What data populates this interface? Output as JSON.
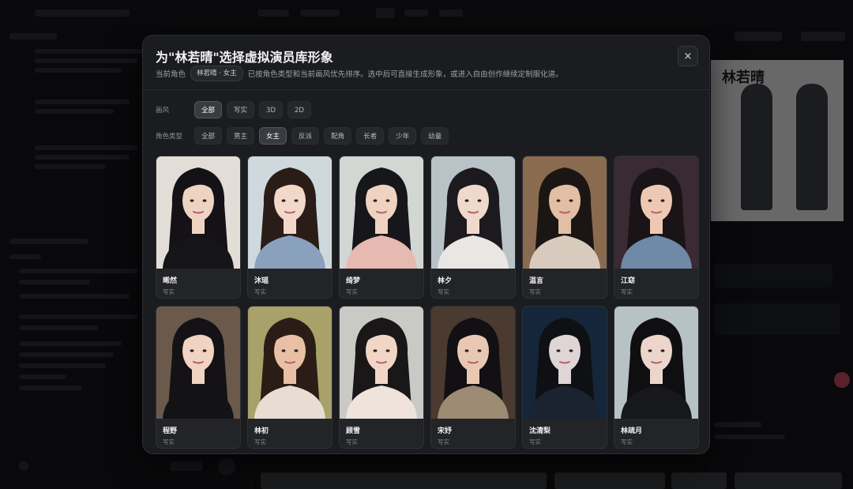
{
  "modal": {
    "title": "为\"林若晴\"选择虚拟演员库形象",
    "subtitle_prefix": "当前角色",
    "current_role_chip": "林若晴 · 女主",
    "subtitle_desc": "已按角色类型和当前画风优先排序。选中后可直接生成形象，或进入自由创作继续定制服化道。",
    "close_label": "×"
  },
  "filters": {
    "style": {
      "label": "画风",
      "options": [
        "全部",
        "写实",
        "3D",
        "2D"
      ],
      "selected": "全部"
    },
    "role_type": {
      "label": "角色类型",
      "options": [
        "全部",
        "男主",
        "女主",
        "反派",
        "配角",
        "长者",
        "少年",
        "幼童"
      ],
      "selected": "女主"
    }
  },
  "actors": [
    {
      "name": "晞然",
      "style": "写实",
      "bg": "#e3ddd8",
      "hair": "#141216",
      "skin": "#efd3c2",
      "cloth": "#151518"
    },
    {
      "name": "沐瑶",
      "style": "写实",
      "bg": "#cfd9dd",
      "hair": "#2a1d18",
      "skin": "#f1d8c9",
      "cloth": "#8aa1bd"
    },
    {
      "name": "绮梦",
      "style": "写实",
      "bg": "#d3d7d4",
      "hair": "#17161a",
      "skin": "#efd2c0",
      "cloth": "#e6b9b1"
    },
    {
      "name": "林夕",
      "style": "写实",
      "bg": "#b9c2c6",
      "hair": "#1c1a1e",
      "skin": "#efd8cc",
      "cloth": "#e9e6e4"
    },
    {
      "name": "温言",
      "style": "写实",
      "bg": "#8a6b50",
      "hair": "#1b1614",
      "skin": "#e2bea4",
      "cloth": "#d8cbbd"
    },
    {
      "name": "江窈",
      "style": "写实",
      "bg": "#3a2a34",
      "hair": "#1a1416",
      "skin": "#edc9b3",
      "cloth": "#6f8aa6"
    },
    {
      "name": "程野",
      "style": "写实",
      "bg": "#6b5a4c",
      "hair": "#141214",
      "skin": "#f0d3c3",
      "cloth": "#131315"
    },
    {
      "name": "林初",
      "style": "写实",
      "bg": "#a9a16a",
      "hair": "#2b1d16",
      "skin": "#e7c0a5",
      "cloth": "#e8ddd3"
    },
    {
      "name": "顾雪",
      "style": "写实",
      "bg": "#c9cac6",
      "hair": "#1a1719",
      "skin": "#f1d6c6",
      "cloth": "#efe3db"
    },
    {
      "name": "宋妤",
      "style": "写实",
      "bg": "#4a3a30",
      "hair": "#121013",
      "skin": "#e9c8b3",
      "cloth": "#9c8a72"
    },
    {
      "name": "沈清梨",
      "style": "写实",
      "bg": "#15263a",
      "hair": "#0f1014",
      "skin": "#dfd4d6",
      "cloth": "#1b2230"
    },
    {
      "name": "林疏月",
      "style": "写实",
      "bg": "#b6c2c6",
      "hair": "#0f0f12",
      "skin": "#ecd6cc",
      "cloth": "#17181c"
    }
  ]
}
